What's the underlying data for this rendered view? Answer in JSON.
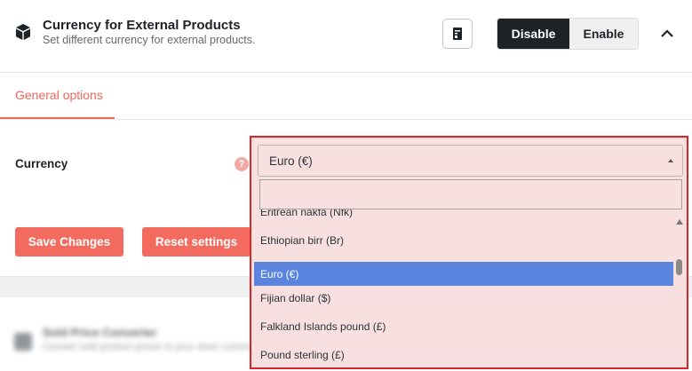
{
  "module": {
    "title": "Currency for External Products",
    "subtitle": "Set different currency for external products.",
    "icon": "box-icon",
    "doc_icon": "document-icon",
    "toggle": {
      "disable_label": "Disable",
      "enable_label": "Enable",
      "active": "Disable"
    },
    "collapse_icon": "chevron-up-icon"
  },
  "tabs": [
    {
      "label": "General options",
      "active": true
    }
  ],
  "fields": {
    "currency": {
      "label": "Currency",
      "help_icon": "question-icon",
      "help_glyph": "?",
      "selected": "Euro (€)",
      "search_value": "",
      "options": [
        "Eritrean nakfa (Nfk)",
        "Ethiopian birr (Br)",
        "Euro (€)",
        "Fijian dollar ($)",
        "Falkland Islands pound (£)",
        "Pound sterling (£)"
      ],
      "highlighted": "Euro (€)"
    }
  },
  "actions": {
    "save_label": "Save Changes",
    "reset_label": "Reset settings"
  },
  "blurred_module": {
    "title": "Sold Price Converter",
    "subtitle": "Convert sold product prices to your store currency."
  },
  "colors": {
    "accent": "#f36b5f",
    "tab_accent": "#f0665b",
    "dark_button": "#1d2327",
    "highlight": "#d8262a",
    "selected_option": "#5a84dd"
  }
}
